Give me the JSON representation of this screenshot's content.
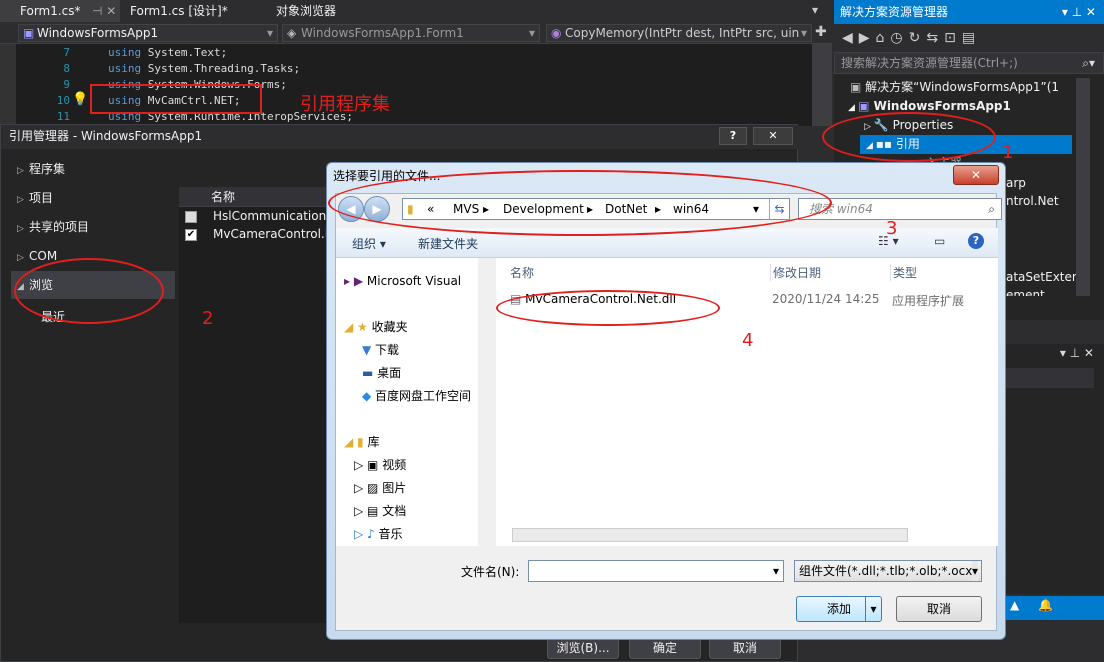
{
  "vs": {
    "tabs": [
      "Form1.cs*",
      "Form1.cs [设计]*",
      "对象浏览器"
    ],
    "nav": {
      "project": "WindowsFormsApp1",
      "class": "WindowsFormsApp1.Form1",
      "member": "CopyMemory(IntPtr dest, IntPtr src, uin"
    },
    "code": [
      {
        "line": "7",
        "kw": "using",
        "ns": "System.Text;"
      },
      {
        "line": "8",
        "kw": "using",
        "ns": "System.Threading.Tasks;"
      },
      {
        "line": "9",
        "kw": "using",
        "ns": "System.Windows.Forms;"
      },
      {
        "line": "10",
        "kw": "using",
        "ns": "MvCamCtrl.NET;"
      },
      {
        "line": "11",
        "kw": "using",
        "ns": "System.Runtime.InteropServices;"
      }
    ],
    "annotation_ref_assembly": "引用程序集"
  },
  "ref_manager": {
    "title": "引用管理器 - WindowsFormsApp1",
    "help": "?",
    "close": "✕",
    "tree": [
      "程序集",
      "项目",
      "共享的项目",
      "COM",
      "浏览",
      "最近"
    ],
    "column_name": "名称",
    "items": [
      {
        "name": "HslCommunication.",
        "checked": false
      },
      {
        "name": "MvCameraControl.N",
        "checked": true
      }
    ],
    "buttons": {
      "browse": "浏览(B)...",
      "ok": "确定",
      "cancel": "取消"
    }
  },
  "solution_explorer": {
    "title": "解决方案资源管理器",
    "search_placeholder": "搜索解决方案资源管理器(Ctrl+;)",
    "solution": "解决方案“WindowsFormsApp1”(1",
    "project": "WindowsFormsApp1",
    "properties": "Properties",
    "references": "引用",
    "partial": [
      "入主器",
      "arp",
      "ntrol.Net",
      "ataSetExter",
      "ement"
    ]
  },
  "file_dialog": {
    "title": "选择要引用的文件...",
    "breadcrumb": [
      "«",
      "MVS",
      "Development",
      "DotNet",
      "win64"
    ],
    "search_placeholder": "搜索 win64",
    "organize": "组织 ▾",
    "new_folder": "新建文件夹",
    "nav": {
      "vs": "Microsoft Visual",
      "favorites": "收藏夹",
      "fav_items": [
        "下载",
        "桌面",
        "百度网盘工作空间"
      ],
      "library": "库",
      "lib_items": [
        "视频",
        "图片",
        "文档",
        "音乐"
      ]
    },
    "columns": [
      "名称",
      "修改日期",
      "类型"
    ],
    "files": [
      {
        "name": "MvCameraControl.Net.dll",
        "date": "2020/11/24 14:25",
        "type": "应用程序扩展"
      }
    ],
    "filename_label": "文件名(N):",
    "filename_value": "",
    "filter": "组件文件(*.dll;*.tlb;*.olb;*.ocx;",
    "add": "添加",
    "cancel": "取消"
  },
  "annotations": [
    "1",
    "2",
    "3",
    "4"
  ],
  "colors": {
    "vs_dark": "#2d2d30",
    "accent": "#007acc",
    "annotation_red": "#e0201c"
  }
}
